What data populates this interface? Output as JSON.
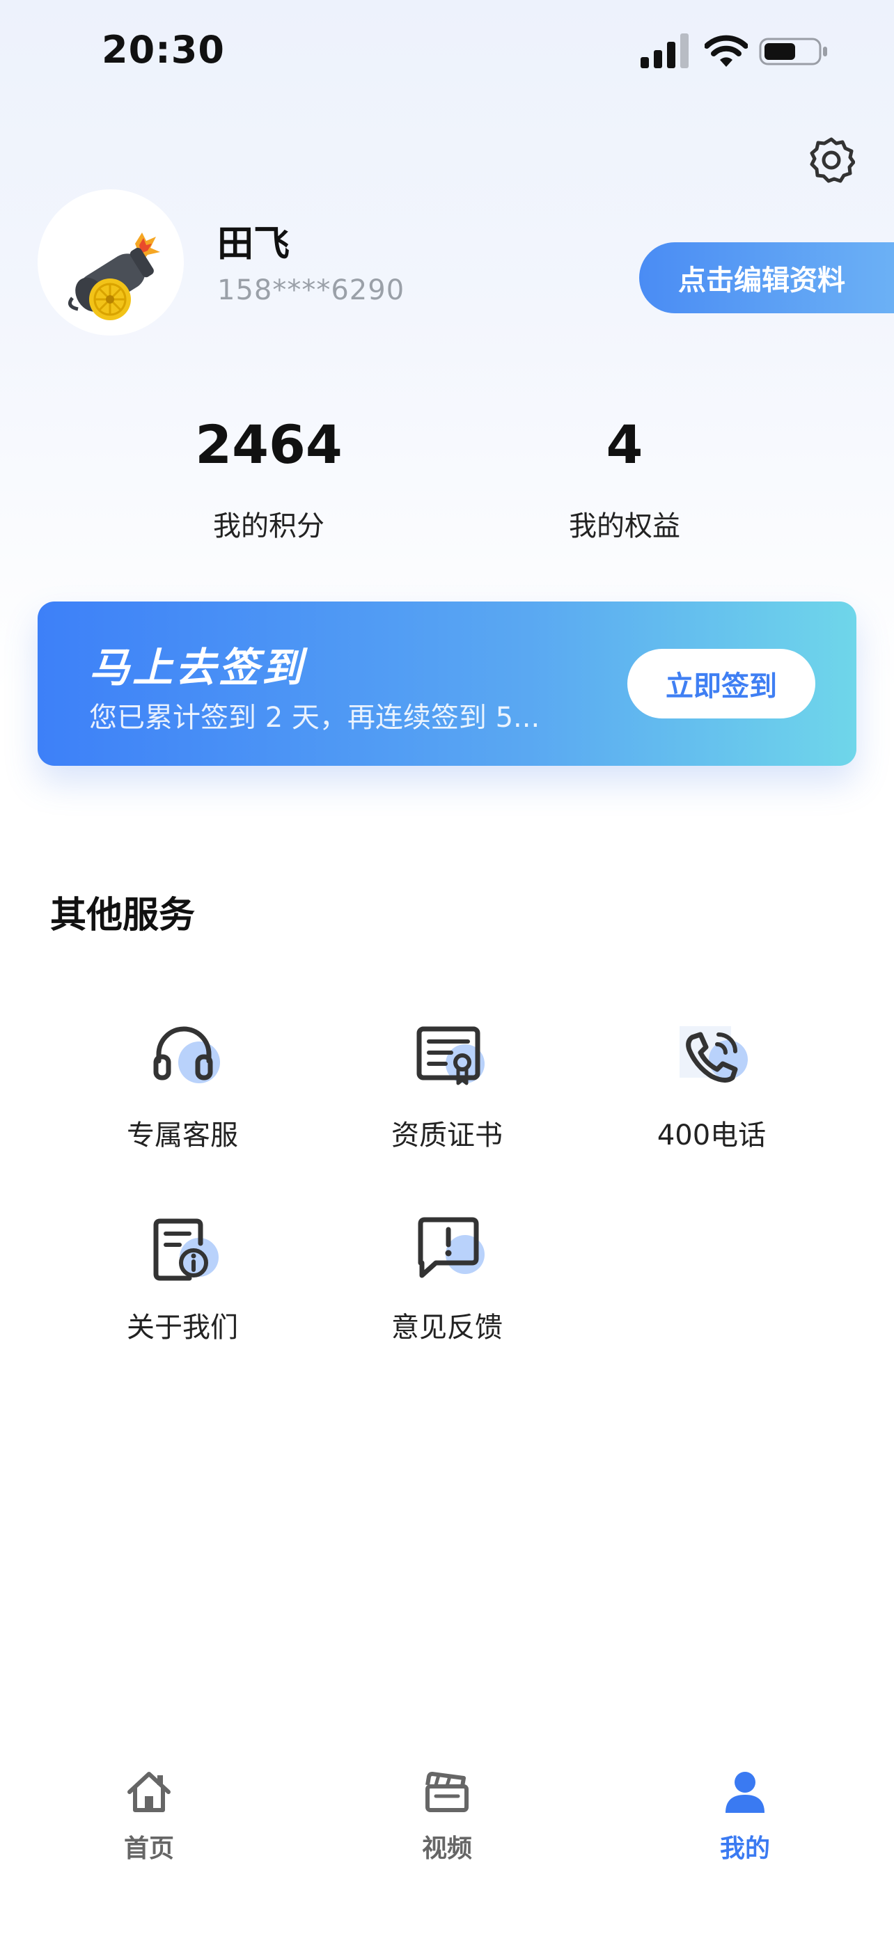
{
  "status_bar": {
    "time": "20:30",
    "icons": [
      "cellular-signal-icon",
      "wifi-icon",
      "battery-icon"
    ]
  },
  "header": {
    "settings_icon": "gear-icon"
  },
  "profile": {
    "avatar": "cannon-avatar",
    "name": "田飞",
    "phone": "158****6290",
    "edit_button": "点击编辑资料"
  },
  "stats": [
    {
      "value": "2464",
      "label": "我的积分"
    },
    {
      "value": "4",
      "label": "我的权益"
    }
  ],
  "signin": {
    "title": "马上去签到",
    "subtitle": "您已累计签到 2 天，再连续签到 5...",
    "button": "立即签到"
  },
  "services": {
    "title": "其他服务",
    "items": [
      {
        "label": "专属客服",
        "icon": "headset-icon"
      },
      {
        "label": "资质证书",
        "icon": "certificate-icon"
      },
      {
        "label": "400电话",
        "icon": "phone-call-icon"
      },
      {
        "label": "关于我们",
        "icon": "info-document-icon"
      },
      {
        "label": "意见反馈",
        "icon": "feedback-icon"
      }
    ]
  },
  "tabbar": {
    "active_color": "#3a7af2",
    "inactive_color": "#666666",
    "items": [
      {
        "label": "首页",
        "icon": "home-icon",
        "active": false
      },
      {
        "label": "视频",
        "icon": "clapperboard-icon",
        "active": false
      },
      {
        "label": "我的",
        "icon": "user-icon",
        "active": true
      }
    ]
  },
  "colors": {
    "accent": "#3f7ff3",
    "icon_highlight": "#b9d2fb"
  }
}
